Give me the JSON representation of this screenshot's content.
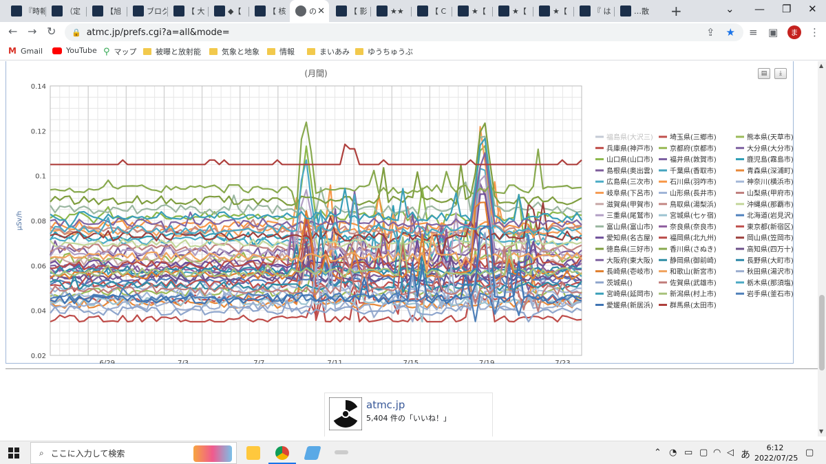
{
  "tabs": [
    {
      "title": "『時報",
      "favicon": "dark"
    },
    {
      "title": "（定",
      "favicon": "dark"
    },
    {
      "title": "【旭",
      "favicon": "dark"
    },
    {
      "title": "ブログ",
      "favicon": "info"
    },
    {
      "title": "【 大",
      "favicon": "dark"
    },
    {
      "title": "◆【",
      "favicon": "dark"
    },
    {
      "title": "【 核",
      "favicon": "dark"
    },
    {
      "title": "の",
      "favicon": "globe",
      "active": true
    },
    {
      "title": "【 影",
      "favicon": "dark"
    },
    {
      "title": "★★",
      "favicon": "dark"
    },
    {
      "title": "【 C",
      "favicon": "dark"
    },
    {
      "title": "★【",
      "favicon": "dark"
    },
    {
      "title": "★【",
      "favicon": "dark"
    },
    {
      "title": "★【",
      "favicon": "dark"
    },
    {
      "title": "『 は",
      "favicon": "dark"
    },
    {
      "title": "…散",
      "favicon": "dark"
    }
  ],
  "browser": {
    "url": "atmc.jp/prefs.cgi?a=all&mode=",
    "avatar_letter": "ま",
    "bookmarks": [
      {
        "label": "Gmail",
        "icon": "gmail-icon"
      },
      {
        "label": "YouTube",
        "icon": "youtube-icon"
      },
      {
        "label": "マップ",
        "icon": "maps-icon"
      },
      {
        "label": "被曝と放射能",
        "icon": "folder-icon"
      },
      {
        "label": "気象と地象",
        "icon": "folder-icon"
      },
      {
        "label": "情報",
        "icon": "folder-icon"
      },
      {
        "label": "まいあみ",
        "icon": "folder-icon"
      },
      {
        "label": "ゆうちゅうぶ",
        "icon": "folder-icon"
      }
    ]
  },
  "chart_data": {
    "type": "line",
    "title": "(月間)",
    "ylabel": "μSv/h",
    "ylim": [
      0.02,
      0.14
    ],
    "yticks": [
      "0.02",
      "0.04",
      "0.06",
      "0.08",
      "0.1",
      "0.12",
      "0.14"
    ],
    "xlim": [
      26,
      54
    ],
    "xticks": [
      {
        "day": 29,
        "label": "6/29"
      },
      {
        "day": 33,
        "label": "7/3"
      },
      {
        "day": 37,
        "label": "7/7"
      },
      {
        "day": 41,
        "label": "7/11"
      },
      {
        "day": 45,
        "label": "7/15"
      },
      {
        "day": 49,
        "label": "7/19"
      },
      {
        "day": 53,
        "label": "7/23"
      }
    ],
    "grid": true,
    "legend_position": "right",
    "series": [
      {
        "name": "福島県(大沢三)",
        "color": "#c4cbd6",
        "base": 0.0,
        "hidden": true
      },
      {
        "name": "埼玉県(三郷市)",
        "color": "#c0504d",
        "base": 0.045
      },
      {
        "name": "熊本県(天草市)",
        "color": "#9bbb59",
        "base": 0.048
      },
      {
        "name": "兵庫県(神戸市)",
        "color": "#be4b48",
        "base": 0.036
      },
      {
        "name": "京都府(京都市)",
        "color": "#98b954",
        "base": 0.063
      },
      {
        "name": "大分県(大分市)",
        "color": "#7d60a0",
        "base": 0.059
      },
      {
        "name": "山口県(山口市)",
        "color": "#8cb84b",
        "base": 0.082
      },
      {
        "name": "福井県(敦賀市)",
        "color": "#7b5fa0",
        "base": 0.054
      },
      {
        "name": "鹿児島(霧島市)",
        "color": "#2c9db5",
        "base": 0.073
      },
      {
        "name": "島根県(奥出雲)",
        "color": "#7e5e9c",
        "base": 0.066
      },
      {
        "name": "千葉県(香取市)",
        "color": "#45a4bf",
        "base": 0.057
      },
      {
        "name": "青森県(深浦町)",
        "color": "#e7893a",
        "base": 0.043
      },
      {
        "name": "広島県(三次市)",
        "color": "#4bacc6",
        "base": 0.071
      },
      {
        "name": "石川県(羽咋市)",
        "color": "#f79646",
        "base": 0.078
      },
      {
        "name": "神奈川(横浜市)",
        "color": "#a5b8d8",
        "base": 0.047
      },
      {
        "name": "岐阜県(下呂市)",
        "color": "#f59d56",
        "base": 0.075
      },
      {
        "name": "山形県(長井市)",
        "color": "#9fb4d7",
        "base": 0.05
      },
      {
        "name": "山梨県(甲府市)",
        "color": "#c0807e",
        "base": 0.068
      },
      {
        "name": "滋賀県(甲賀市)",
        "color": "#c8a8a7",
        "base": 0.062
      },
      {
        "name": "鳥取県(湯梨浜)",
        "color": "#c48985",
        "base": 0.076
      },
      {
        "name": "沖縄県(那覇市)",
        "color": "#c4d79b",
        "base": 0.07
      },
      {
        "name": "三重県(尾鷲市)",
        "color": "#b29fc4",
        "base": 0.066
      },
      {
        "name": "宮城県(七ヶ宿)",
        "color": "#9cc3d1",
        "base": 0.044
      },
      {
        "name": "北海道(岩見沢)",
        "color": "#4f81bd",
        "base": 0.053
      },
      {
        "name": "富山県(富山市)",
        "color": "#9ab7a0",
        "base": 0.085
      },
      {
        "name": "奈良県(奈良市)",
        "color": "#8e5e9e",
        "base": 0.058
      },
      {
        "name": "東京都(新宿区)",
        "color": "#c0504d",
        "base": 0.052
      },
      {
        "name": "愛知県(名古屋)",
        "color": "#6e4f9a",
        "base": 0.061
      },
      {
        "name": "福岡県(北九州)",
        "color": "#b94a47",
        "base": 0.06
      },
      {
        "name": "岡山県(笠岡市)",
        "color": "#9d3f3c",
        "base": 0.073
      },
      {
        "name": "徳島県(三好市)",
        "color": "#7f9e3f",
        "base": 0.089
      },
      {
        "name": "香川県(さぬき)",
        "color": "#88a94e",
        "base": 0.094
      },
      {
        "name": "高知県(四万十)",
        "color": "#6c5089",
        "base": 0.055
      },
      {
        "name": "大阪府(東大阪)",
        "color": "#8064a2",
        "base": 0.079
      },
      {
        "name": "静岡県(御前崎)",
        "color": "#2f8ea5",
        "base": 0.051
      },
      {
        "name": "長野県(大町市)",
        "color": "#2e89a8",
        "base": 0.058
      },
      {
        "name": "長崎県(壱岐市)",
        "color": "#e07f2e",
        "base": 0.056
      },
      {
        "name": "和歌山(新宮市)",
        "color": "#f0a35e",
        "base": 0.064
      },
      {
        "name": "秋田県(湯沢市)",
        "color": "#9caed0",
        "base": 0.042
      },
      {
        "name": "茨城県()",
        "color": "#8ea5cc",
        "base": 0.04
      },
      {
        "name": "佐賀県(武雄市)",
        "color": "#c07c7a",
        "base": 0.049
      },
      {
        "name": "栃木県(那須塩)",
        "color": "#4aa8c3",
        "base": 0.076
      },
      {
        "name": "宮崎県(延岡市)",
        "color": "#3a9fb8",
        "base": 0.082
      },
      {
        "name": "新潟県(村上市)",
        "color": "#a7c27a",
        "base": 0.057
      },
      {
        "name": "岩手県(釜石市)",
        "color": "#4e7fb8",
        "base": 0.046
      },
      {
        "name": "愛媛県(新居浜)",
        "color": "#3f74b3",
        "base": 0.045
      },
      {
        "name": "群馬県(太田市)",
        "color": "#ae3f3c",
        "base": 0.105
      }
    ]
  },
  "facebook": {
    "name": "atmc.jp",
    "likes": "5,404 件の「いいね！」"
  },
  "taskbar": {
    "search_placeholder": "ここに入力して検索",
    "ime": "あ",
    "time": "6:12",
    "date": "2022/07/25"
  }
}
